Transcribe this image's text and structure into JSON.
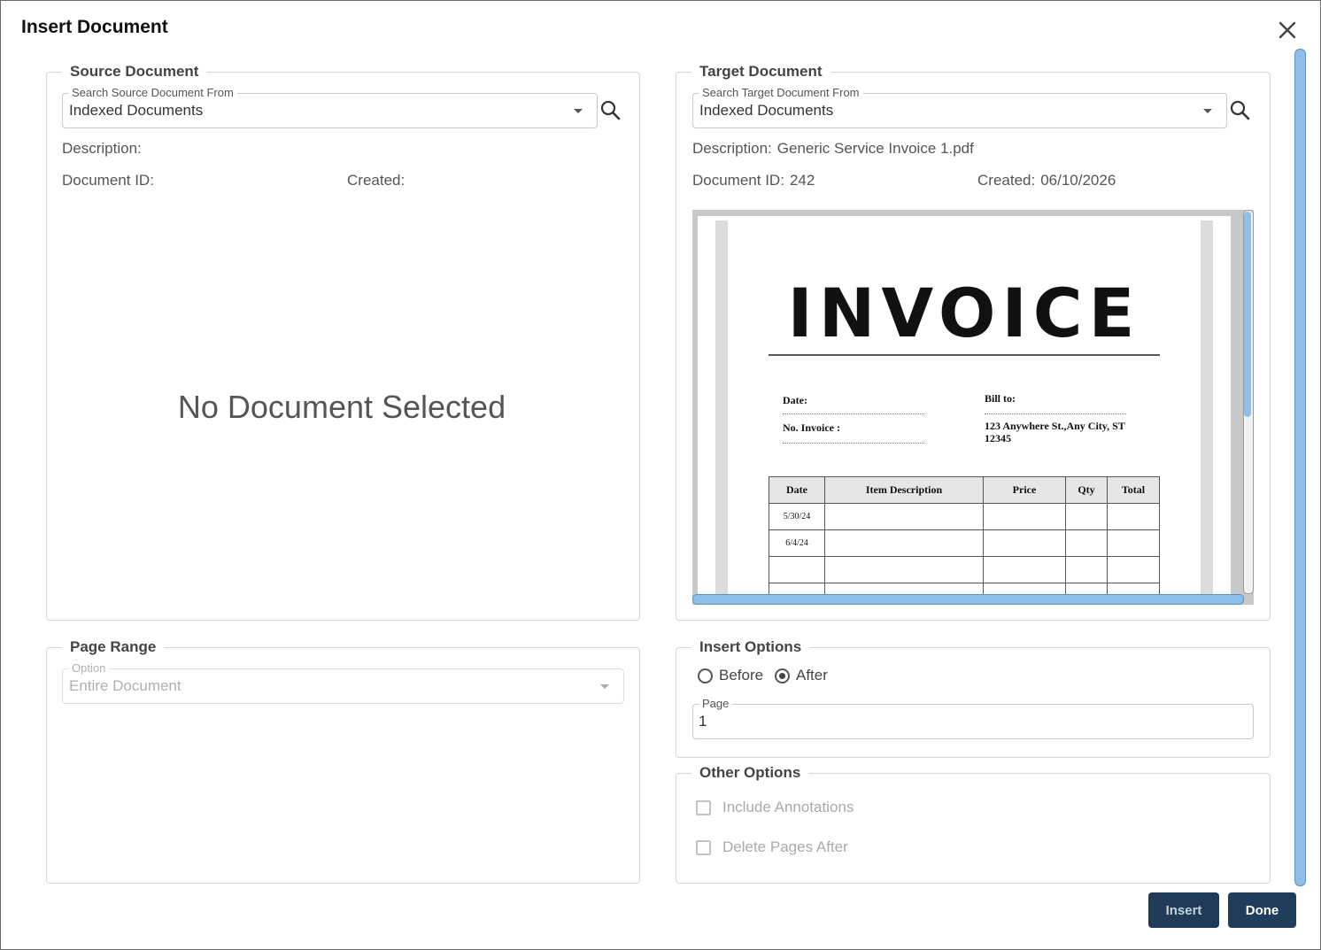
{
  "dialog": {
    "title": "Insert Document"
  },
  "source": {
    "legend": "Source Document",
    "search_label": "Search Source Document From",
    "search_value": "Indexed Documents",
    "description_label": "Description:",
    "description_value": "",
    "docid_label": "Document ID:",
    "docid_value": "",
    "created_label": "Created:",
    "created_value": "",
    "empty_text": "No Document Selected"
  },
  "target": {
    "legend": "Target Document",
    "search_label": "Search Target Document From",
    "search_value": "Indexed Documents",
    "description_label": "Description:",
    "description_value": "Generic Service Invoice 1.pdf",
    "docid_label": "Document ID:",
    "docid_value": "242",
    "created_label": "Created:",
    "created_value": "06/10/2026",
    "preview": {
      "heading": "INVOICE",
      "date_label": "Date:",
      "invoice_no_label": "No. Invoice :",
      "bill_to_label": "Bill to:",
      "bill_to_address": "123 Anywhere St.,Any City, ST 12345",
      "columns": [
        "Date",
        "Item Description",
        "Price",
        "Qty",
        "Total"
      ],
      "rows": [
        [
          "5/30/24",
          "",
          "",
          "",
          ""
        ],
        [
          "6/4/24",
          "",
          "",
          "",
          ""
        ],
        [
          "",
          "",
          "",
          "",
          ""
        ],
        [
          "",
          "",
          "",
          "",
          ""
        ]
      ]
    }
  },
  "page_range": {
    "legend": "Page Range",
    "option_label": "Option",
    "option_value": "Entire Document"
  },
  "insert_options": {
    "legend": "Insert Options",
    "before_label": "Before",
    "after_label": "After",
    "selected": "After",
    "page_label": "Page",
    "page_value": "1"
  },
  "other_options": {
    "legend": "Other Options",
    "include_annotations_label": "Include Annotations",
    "include_annotations_checked": false,
    "delete_pages_label": "Delete Pages After",
    "delete_pages_checked": false
  },
  "buttons": {
    "insert": "Insert",
    "done": "Done"
  },
  "icons": {
    "close": "close-icon",
    "search": "search-icon",
    "dropdown": "chevron-down-icon"
  },
  "colors": {
    "button_bg": "#1e3e5c",
    "scrollbar": "#8fbfe8"
  }
}
